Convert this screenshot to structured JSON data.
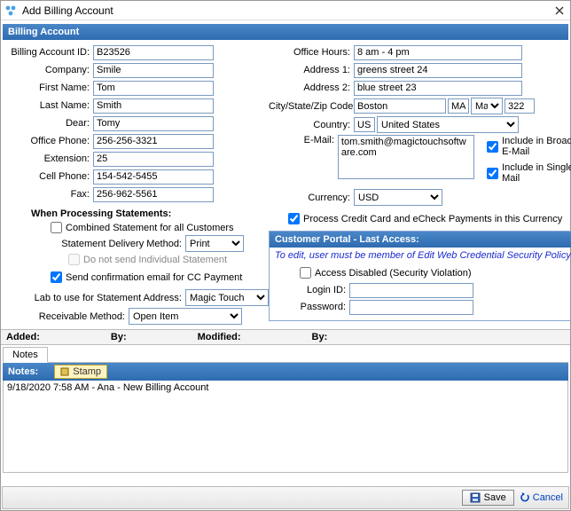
{
  "window": {
    "title": "Add Billing Account"
  },
  "header1": "Billing Account",
  "left": {
    "labels": {
      "billing_id": "Billing Account ID:",
      "company": "Company:",
      "first_name": "First Name:",
      "last_name": "Last Name:",
      "dear": "Dear:",
      "office_phone": "Office Phone:",
      "extension": "Extension:",
      "cell_phone": "Cell Phone:",
      "fax": "Fax:"
    },
    "values": {
      "billing_id": "B23526",
      "company": "Smile",
      "first_name": "Tom",
      "last_name": "Smith",
      "dear": "Tomy",
      "office_phone": "256-256-3321",
      "extension": "25",
      "cell_phone": "154-542-5455",
      "fax": "256-962-5561"
    },
    "processing_header": "When Processing Statements:",
    "combined_label": "Combined Statement for all Customers",
    "delivery_label": "Statement Delivery Method:",
    "delivery_value": "Print",
    "no_individual_label": "Do not send Individual Statement",
    "send_conf_label": "Send confirmation email for CC Payment",
    "lab_label": "Lab to use for Statement Address:",
    "lab_value": "Magic Touch",
    "recv_label": "Receivable Method:",
    "recv_value": "Open Item"
  },
  "right": {
    "labels": {
      "office_hours": "Office Hours:",
      "address1": "Address 1:",
      "address2": "Address 2:",
      "csz": "City/State/Zip Code:",
      "country": "Country:",
      "email": "E-Mail:",
      "currency": "Currency:"
    },
    "values": {
      "office_hours": "8 am - 4 pm",
      "address1": "greens street 24",
      "address2": "blue street 23",
      "city": "Boston",
      "state": "MA",
      "state2": "Ma:",
      "zip": "322",
      "country_code": "US",
      "country_name": "United States",
      "email": "tom.smith@magictouchsoftware.com",
      "currency": "USD"
    },
    "include_broadcast": "Include in Broadcast E-Mail",
    "include_single": "Include in Single E-Mail",
    "process_cc": "Process Credit Card and eCheck Payments in this Currency",
    "portal": {
      "header": "Customer Portal - Last Access:",
      "note": "To edit, user must be member of Edit Web Credential Security Policy",
      "access_disabled": "Access Disabled (Security Violation)",
      "login_label": "Login ID:",
      "password_label": "Password:"
    }
  },
  "meta": {
    "added": "Added:",
    "by1": "By:",
    "modified": "Modified:",
    "by2": "By:"
  },
  "tabs": {
    "notes": "Notes"
  },
  "notes": {
    "header": "Notes:",
    "stamp": "Stamp",
    "entry": "9/18/2020 7:58 AM - Ana - New Billing Account"
  },
  "footer": {
    "save": "Save",
    "cancel": "Cancel"
  }
}
